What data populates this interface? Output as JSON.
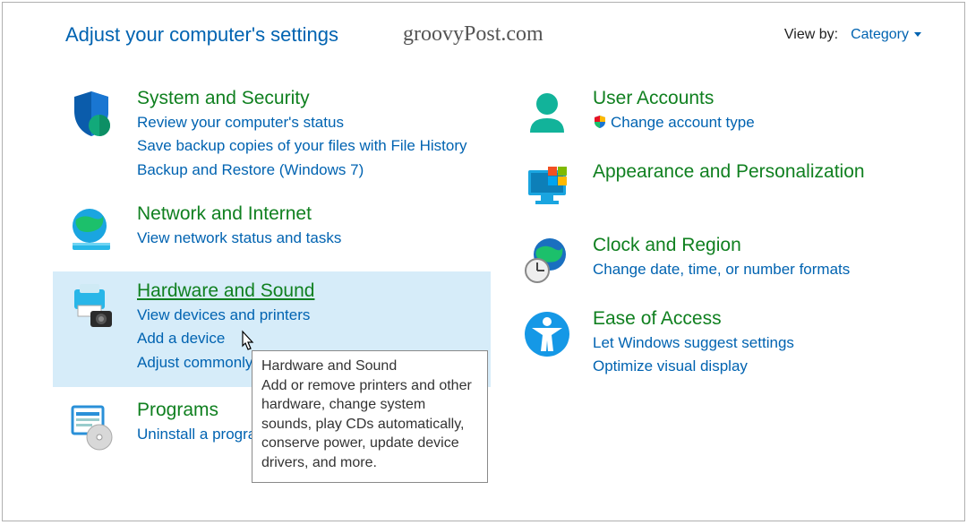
{
  "header": {
    "title": "Adjust your computer's settings",
    "watermark": "groovyPost.com",
    "viewby_label": "View by:",
    "viewby_value": "Category"
  },
  "left": [
    {
      "icon": "shield-security",
      "title": "System and Security",
      "links": [
        {
          "text": "Review your computer's status"
        },
        {
          "text": "Save backup copies of your files with File History"
        },
        {
          "text": "Backup and Restore (Windows 7)"
        }
      ]
    },
    {
      "icon": "globe-network",
      "title": "Network and Internet",
      "links": [
        {
          "text": "View network status and tasks"
        }
      ]
    },
    {
      "icon": "printer-camera",
      "title": "Hardware and Sound",
      "highlight": true,
      "hover": true,
      "links": [
        {
          "text": "View devices and printers"
        },
        {
          "text": "Add a device"
        },
        {
          "text": "Adjust commonly used mobility settings"
        }
      ]
    },
    {
      "icon": "programs-disc",
      "title": "Programs",
      "links": [
        {
          "text": "Uninstall a program"
        }
      ]
    }
  ],
  "right": [
    {
      "icon": "user-accounts",
      "title": "User Accounts",
      "links": [
        {
          "text": "Change account type",
          "shield": true
        }
      ]
    },
    {
      "icon": "monitor-apps",
      "title": "Appearance and Personalization",
      "links": []
    },
    {
      "icon": "globe-clock",
      "title": "Clock and Region",
      "links": [
        {
          "text": "Change date, time, or number formats"
        }
      ]
    },
    {
      "icon": "accessibility",
      "title": "Ease of Access",
      "links": [
        {
          "text": "Let Windows suggest settings"
        },
        {
          "text": "Optimize visual display"
        }
      ]
    }
  ],
  "tooltip": {
    "title": "Hardware and Sound",
    "body": "Add or remove printers and other hardware, change system sounds, play CDs automatically, conserve power, update device drivers, and more."
  }
}
